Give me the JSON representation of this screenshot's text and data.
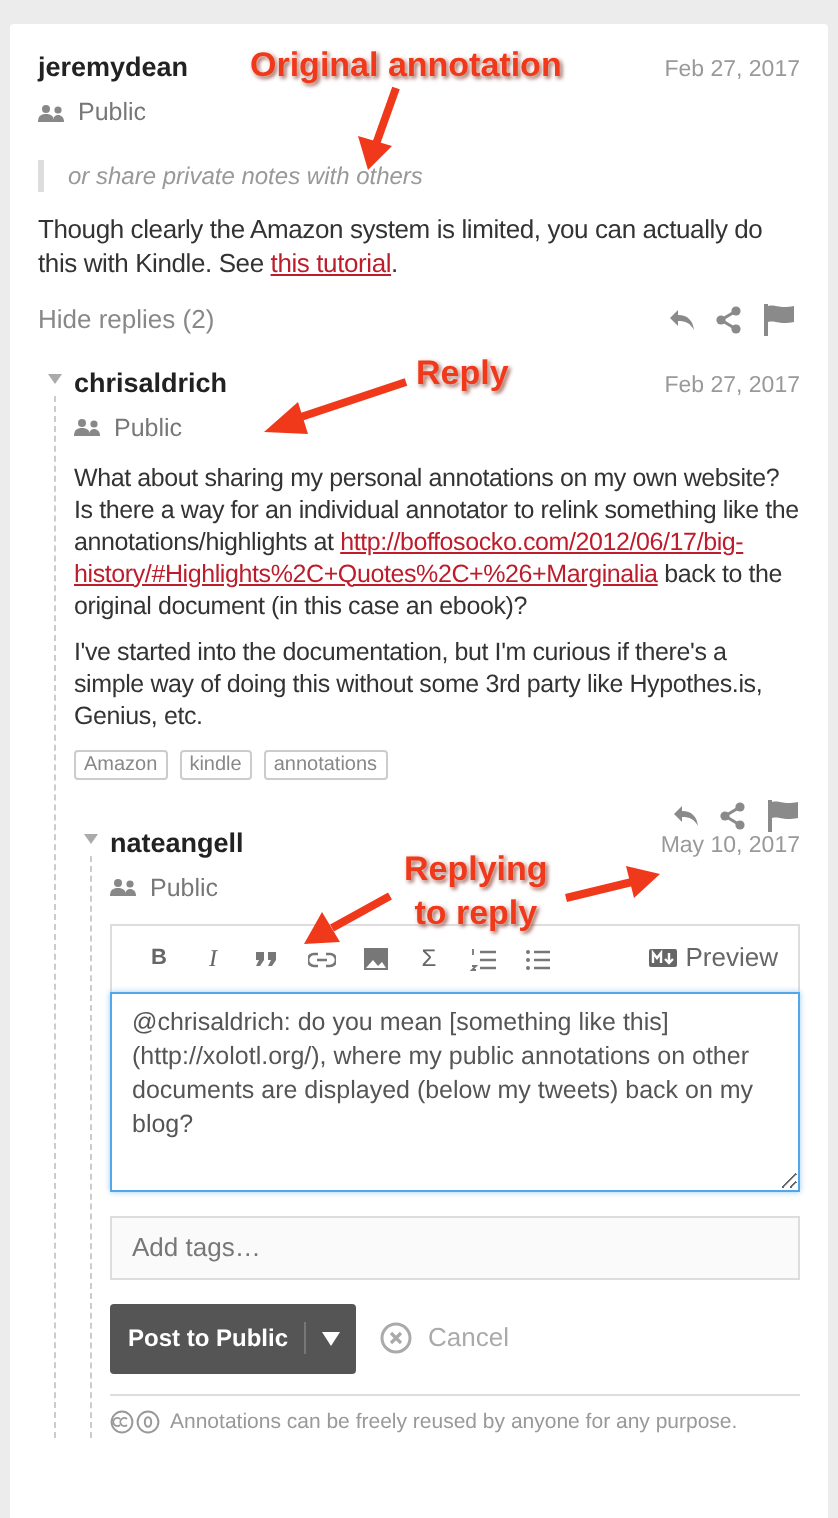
{
  "annotation": {
    "user": "jeremydean",
    "date": "Feb 27, 2017",
    "visibility": "Public",
    "quote": "or share private notes with others",
    "body": {
      "before": "Though clearly the Amazon system is limited, you can actually do this with Kindle. See ",
      "link": [
        "this tutorial"
      ],
      "after": "."
    }
  },
  "replies_toggle": {
    "label": "Hide replies (2)",
    "expanded": true
  },
  "replies": [
    {
      "user": "chrisaldrich",
      "date": "Feb 27, 2017",
      "visibility": "Public",
      "expanded": true,
      "paragraphs": [
        {
          "before": "What about sharing my personal annotations on my own website? Is there a way for an individual annotator to relink something like the annotations/highlights at ",
          "link": [
            "http://boffosocko.com/2012/06/17/big-",
            "history/#Highlights%2C+Quotes%2C+%26+Marginalia"
          ],
          "after": " back to the original document (in this case an ebook)?"
        },
        {
          "before": "I've started into the documentation, but I'm curious if there's a simple way of doing this without some 3rd party like Hypothes.is, Genius, etc."
        }
      ],
      "tags": [
        "Amazon",
        "kindle",
        "annotations"
      ],
      "replies": [
        {
          "user": "nateangell",
          "date": "May 10, 2017",
          "visibility": "Public",
          "expanded": true,
          "editor": {
            "toolbar": [
              {
                "kind": "bold",
                "label": "B"
              },
              {
                "kind": "italic",
                "label": "I"
              },
              {
                "kind": "quote"
              },
              {
                "kind": "link"
              },
              {
                "kind": "image"
              },
              {
                "kind": "math",
                "label": "Σ"
              },
              {
                "kind": "numbered-list"
              },
              {
                "kind": "bullet-list"
              }
            ],
            "preview": "Preview",
            "text": "@chrisaldrich: do you mean [something like this](http://xolotl.org/), where my public annotations on other documents are displayed (below my tweets) back on my blog?",
            "focused": true,
            "tags_placeholder": "Add tags…",
            "post": "Post to Public",
            "cancel": "Cancel"
          }
        }
      ]
    }
  ],
  "license": "Annotations can be freely reused by anyone for any purpose.",
  "callouts": [
    {
      "lines": [
        "Original annotation"
      ]
    },
    {
      "lines": [
        "Reply"
      ]
    },
    {
      "lines": [
        "Replying",
        "to reply"
      ]
    }
  ]
}
